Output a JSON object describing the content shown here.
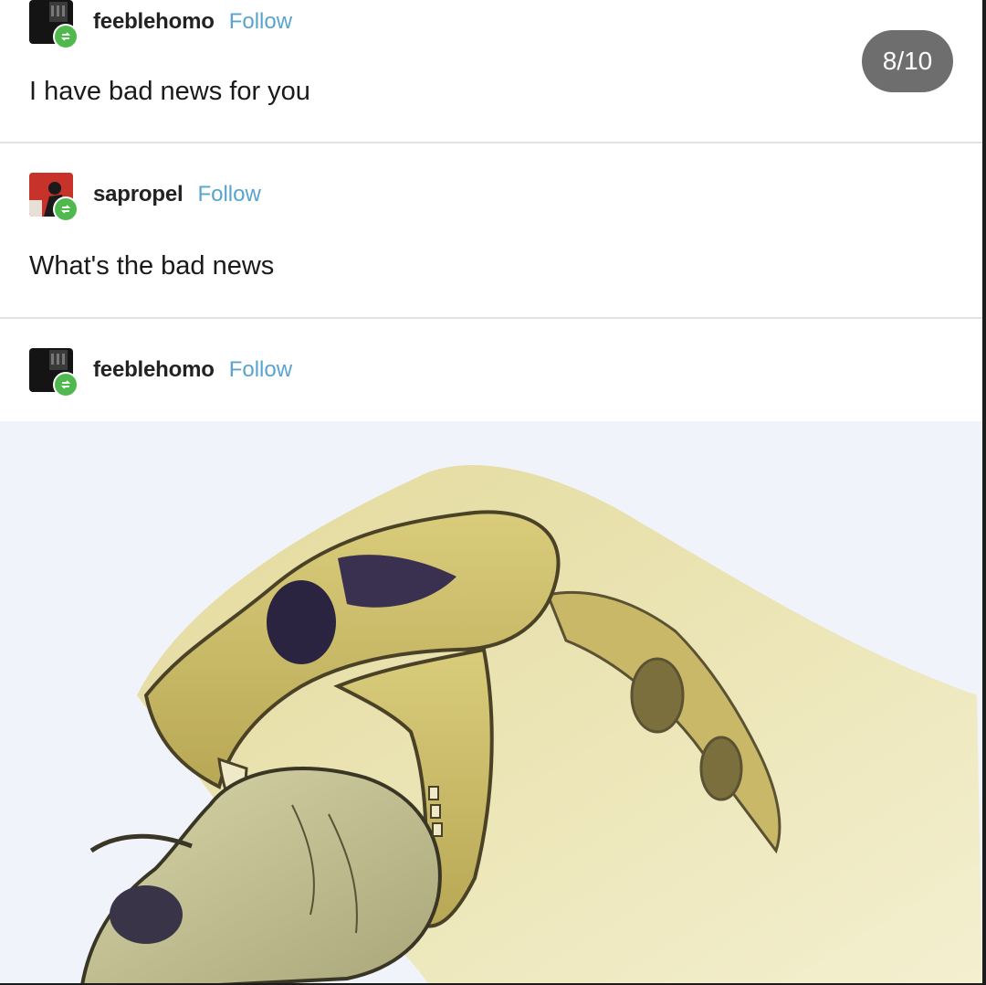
{
  "counter": "8/10",
  "follow_label": "Follow",
  "posts": [
    {
      "username": "feeblehomo",
      "text": "I have bad news for you"
    },
    {
      "username": "sapropel",
      "text": "What's the bad news"
    },
    {
      "username": "feeblehomo",
      "image": "saber-tooth-cat-skull-biting-human-skull-illustration"
    }
  ],
  "colors": {
    "follow": "#58a4cf",
    "reblog_badge": "#4fb84e",
    "counter_bg": "#6e6e6e"
  }
}
